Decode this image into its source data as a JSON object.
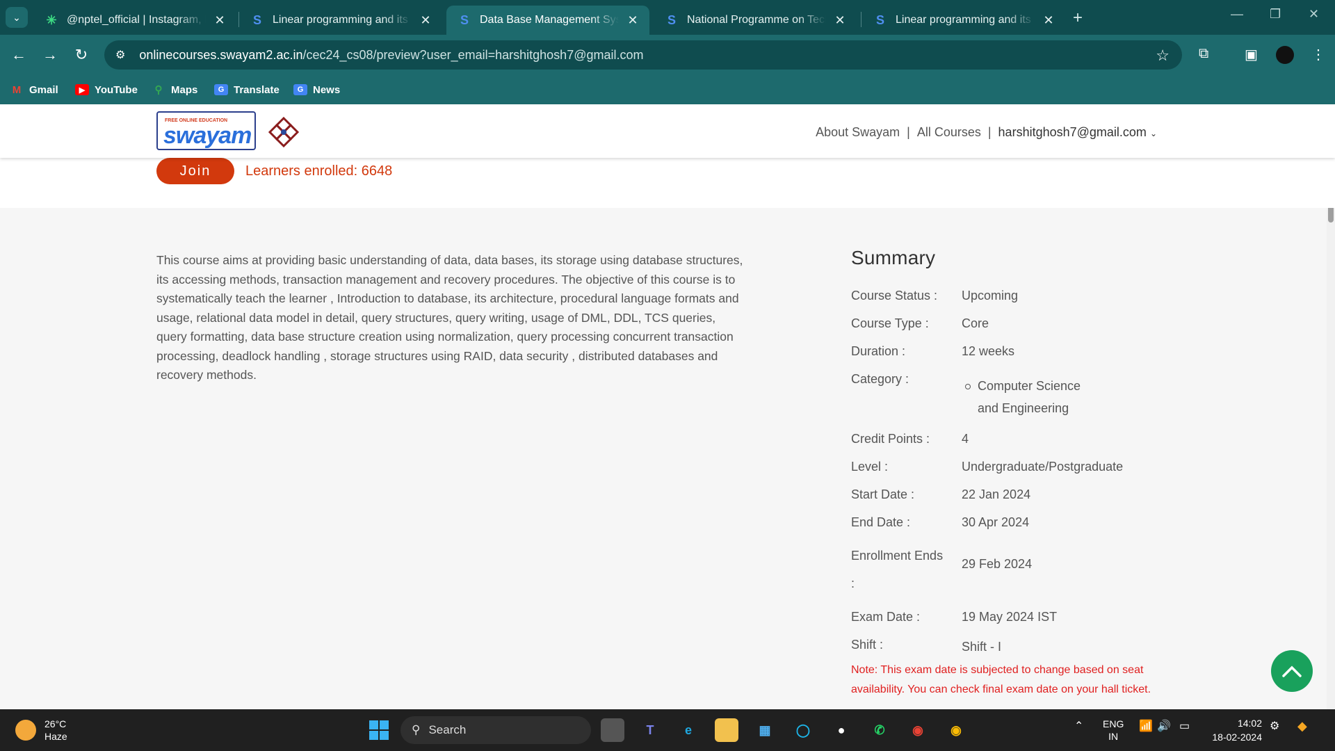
{
  "browser": {
    "tabs": [
      {
        "title": "@nptel_official | Instagram, Fa",
        "favicon": "asterisk-icon",
        "color": "#3ddc84"
      },
      {
        "title": "Linear programming and its ap",
        "favicon": "swayam-s-icon",
        "color": "#2a6fdb"
      },
      {
        "title": "Data Base Management System",
        "favicon": "swayam-s-icon",
        "color": "#2a6fdb"
      },
      {
        "title": "National Programme on Techn",
        "favicon": "swayam-s-icon",
        "color": "#2a6fdb"
      },
      {
        "title": "Linear programming and its ap",
        "favicon": "swayam-s-icon",
        "color": "#2a6fdb"
      }
    ],
    "active_tab": 2,
    "url_host": "onlinecourses.swayam2.ac.in",
    "url_path": "/cec24_cs08/preview?user_email=harshitghosh7@gmail.com",
    "bookmarks": [
      {
        "label": "Gmail",
        "icon": "gmail-icon"
      },
      {
        "label": "YouTube",
        "icon": "youtube-icon"
      },
      {
        "label": "Maps",
        "icon": "maps-icon"
      },
      {
        "label": "Translate",
        "icon": "translate-icon"
      },
      {
        "label": "News",
        "icon": "news-icon"
      }
    ]
  },
  "header": {
    "nav_about": "About Swayam",
    "nav_courses": "All Courses",
    "nav_sep": "|",
    "user_email": "harshitghosh7@gmail.com",
    "logo_text": "swayam",
    "logo_top": "FREE ONLINE EDUCATION"
  },
  "course": {
    "join_label": "Join",
    "enrolled_text": "Learners enrolled: 6648",
    "description": "This course aims at providing basic understanding of data, data bases, its storage using database structures, its accessing methods, transaction management and recovery procedures.  The objective of this course is to systematically teach the learner ,  Introduction to database, its architecture, procedural language formats and usage, relational data model in detail, query structures, query writing, usage of DML, DDL, TCS queries, query formatting, data base structure creation using normalization, query processing concurrent transaction processing, deadlock handling , storage structures using RAID, data security , distributed databases and recovery methods."
  },
  "summary": {
    "heading": "Summary",
    "status_label": "Course Status :",
    "status": "Upcoming",
    "type_label": "Course Type :",
    "type": "Core",
    "duration_label": "Duration :",
    "duration": "12 weeks",
    "category_label": "Category :",
    "category_items": [
      "Computer Science and Engineering"
    ],
    "credits_label": "Credit Points :",
    "credits": "4",
    "level_label": "Level :",
    "level": "Undergraduate/Postgraduate",
    "start_label": "Start Date :",
    "start": "22 Jan 2024",
    "end_label": "End Date :",
    "end": "30 Apr 2024",
    "enroll_label": "Enrollment Ends :",
    "enroll_ends": "29 Feb 2024",
    "exam_label": "Exam Date :",
    "exam": "19 May 2024 IST",
    "shift_label": "Shift :",
    "shift": "Shift - I",
    "note": "Note: This exam date is subjected to change based on seat availability. You can check final exam date on your hall ticket."
  },
  "taskbar": {
    "temp": "26°C",
    "weather": "Haze",
    "search_label": "Search",
    "lang_top": "ENG",
    "lang_bottom": "IN",
    "time": "14:02",
    "date": "18-02-2024"
  },
  "colors": {
    "browser_dark": "#0f4c4f",
    "browser_mid": "#1d6a6d",
    "join": "#d2390d",
    "note": "#e02020",
    "to_top": "#19a15c"
  }
}
